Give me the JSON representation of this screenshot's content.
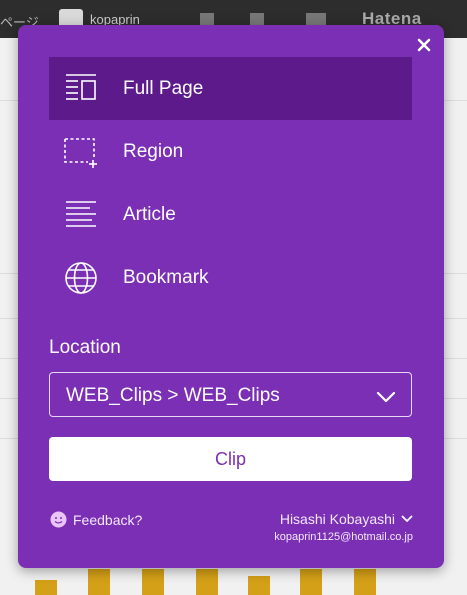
{
  "background": {
    "fragment_left": "ページ",
    "username": "kopaprin",
    "brand": "Hatena"
  },
  "popup": {
    "menu": [
      {
        "label": "Full Page",
        "icon": "full-page-icon",
        "active": true
      },
      {
        "label": "Region",
        "icon": "region-icon",
        "active": false
      },
      {
        "label": "Article",
        "icon": "article-icon",
        "active": false
      },
      {
        "label": "Bookmark",
        "icon": "globe-icon",
        "active": false
      }
    ],
    "location_label": "Location",
    "location_value": "WEB_Clips > WEB_Clips",
    "clip_label": "Clip",
    "feedback_label": "Feedback?",
    "account_name": "Hisashi Kobayashi",
    "account_email": "kopaprin1125@hotmail.co.jp",
    "colors": {
      "popup_bg": "#7b2fb5",
      "active_item_bg": "#5c1a8b",
      "clip_text": "#7b2fb5"
    }
  }
}
